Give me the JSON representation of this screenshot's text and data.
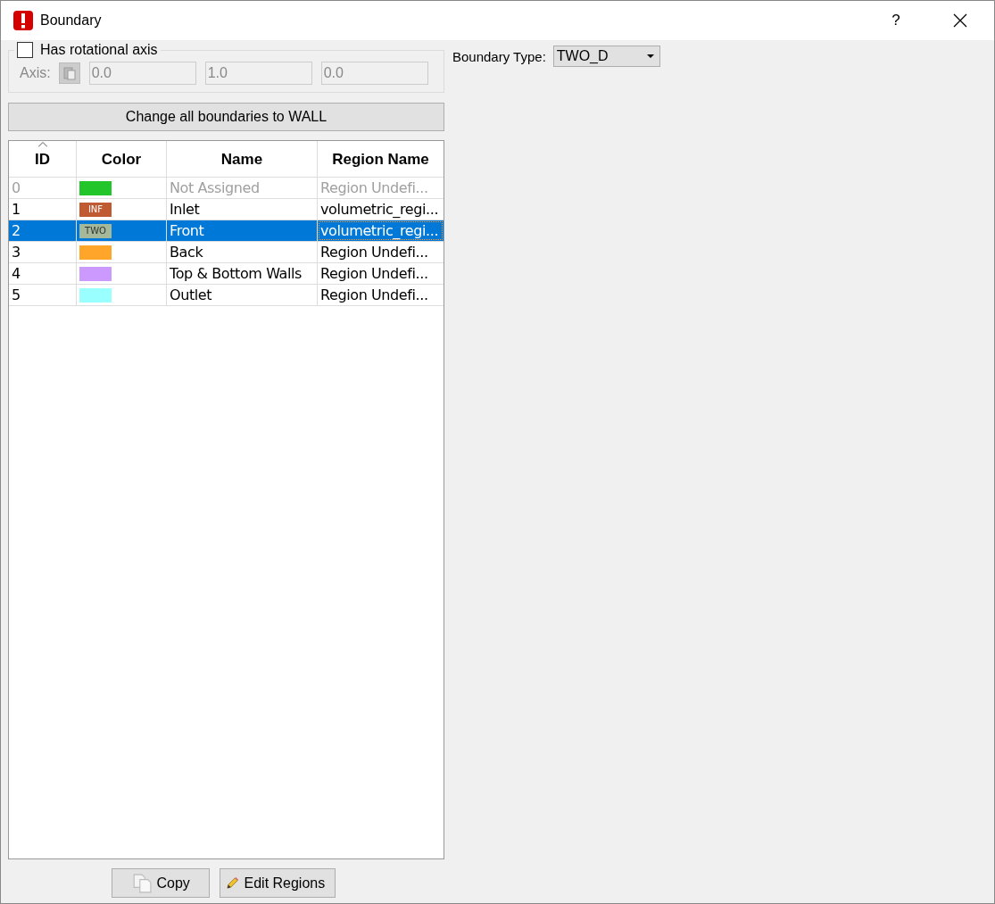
{
  "window": {
    "title": "Boundary",
    "help": "?"
  },
  "rotational_axis": {
    "label": "Has rotational axis",
    "checked": false,
    "axis_label": "Axis:",
    "values": [
      "0.0",
      "1.0",
      "0.0"
    ]
  },
  "boundary_type": {
    "label": "Boundary Type:",
    "value": "TWO_D"
  },
  "change_all_button": "Change all boundaries to WALL",
  "table": {
    "columns": [
      {
        "label": "ID",
        "sorted": true
      },
      {
        "label": "Color",
        "sorted": false
      },
      {
        "label": "Name",
        "sorted": false
      },
      {
        "label": "Region Name",
        "sorted": false
      }
    ],
    "rows": [
      {
        "id": "0",
        "color": "#22c52a",
        "tag": null,
        "name": "Not Assigned",
        "region": "Region Undefi...",
        "disabled": true,
        "selected": false,
        "focused": false
      },
      {
        "id": "1",
        "color": "#c05a33",
        "tag": "INF",
        "name": "Inlet",
        "region": "volumetric_regi...",
        "disabled": false,
        "selected": false,
        "focused": false
      },
      {
        "id": "2",
        "color": "#a5b89a",
        "tag": "TWO",
        "name": "Front",
        "region": "volumetric_regi...",
        "disabled": false,
        "selected": true,
        "focused": true
      },
      {
        "id": "3",
        "color": "#ffa52a",
        "tag": null,
        "name": "Back",
        "region": "Region Undefi...",
        "disabled": false,
        "selected": false,
        "focused": false
      },
      {
        "id": "4",
        "color": "#cc99ff",
        "tag": null,
        "name": "Top & Bottom Walls",
        "region": "Region Undefi...",
        "disabled": false,
        "selected": false,
        "focused": false
      },
      {
        "id": "5",
        "color": "#99ffff",
        "tag": null,
        "name": "Outlet",
        "region": "Region Undefi...",
        "disabled": false,
        "selected": false,
        "focused": false
      }
    ]
  },
  "buttons": [
    {
      "kind": "copy",
      "label": "Copy"
    },
    {
      "kind": "edit",
      "label": "Edit Regions"
    }
  ]
}
